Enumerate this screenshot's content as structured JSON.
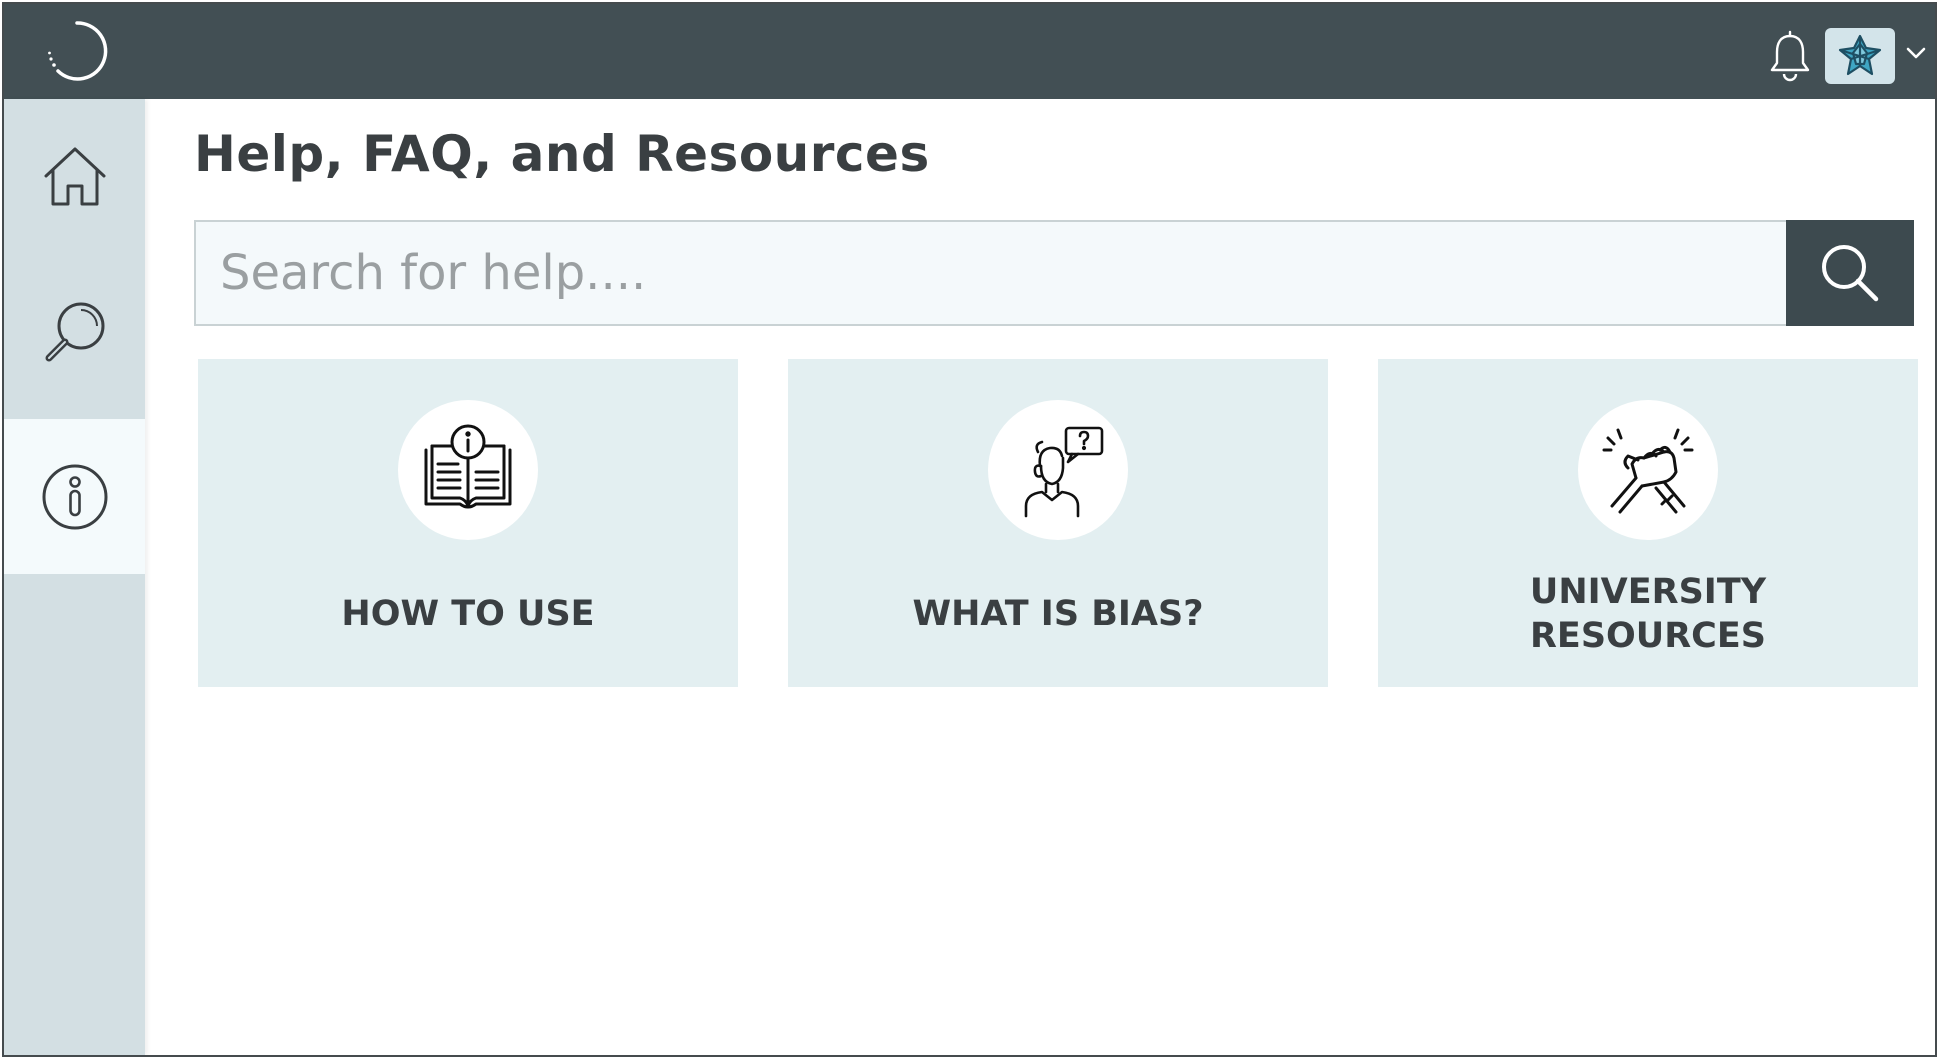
{
  "header": {
    "logo_icon": "loading-ring-logo",
    "notification_icon": "bell-icon",
    "avatar_icon": "geometric-star-avatar",
    "avatar_menu_icon": "chevron-down-icon"
  },
  "sidebar": {
    "items": [
      {
        "icon": "home-icon",
        "active": false
      },
      {
        "icon": "search-icon",
        "active": false
      },
      {
        "icon": "info-icon",
        "active": true
      }
    ]
  },
  "main": {
    "title": "Help, FAQ, and Resources",
    "search": {
      "placeholder": "Search for help....",
      "value": "",
      "button_icon": "search-icon"
    },
    "cards": [
      {
        "label": "HOW TO USE",
        "icon": "info-book-icon"
      },
      {
        "label": "WHAT IS BIAS?",
        "icon": "person-question-icon"
      },
      {
        "label": "UNIVERSITY\nRESOURCES",
        "icon": "handshake-icon"
      }
    ]
  },
  "colors": {
    "topbar": "#424f54",
    "sidebar": "#d3dfe3",
    "sidebar_active": "#f4fafc",
    "card": "#e3eff1",
    "search_button": "#3d4a4f",
    "text": "#3a3f42"
  }
}
